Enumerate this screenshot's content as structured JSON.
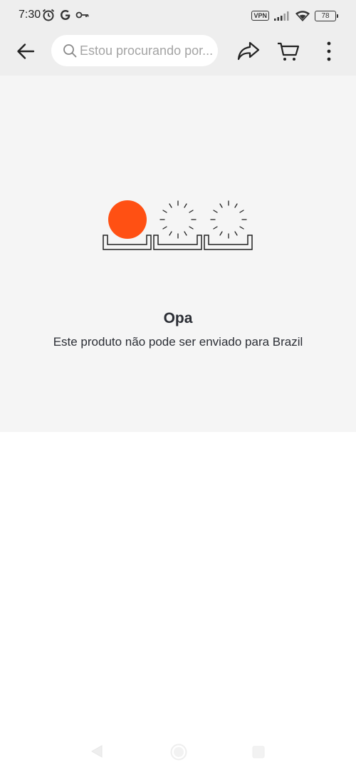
{
  "status_bar": {
    "time": "7:30",
    "left_icons": [
      "alarm-icon",
      "google-icon",
      "key-icon"
    ],
    "vpn_label": "VPN",
    "battery_level": "78",
    "right_icons": [
      "signal-icon",
      "wifi-icon",
      "battery-icon"
    ]
  },
  "header": {
    "back_icon": "arrow-left-icon",
    "search_placeholder": "Estou procurando por...",
    "share_icon": "share-icon",
    "cart_icon": "cart-icon",
    "more_icon": "more-vertical-icon"
  },
  "error": {
    "title": "Opa",
    "message": "Este produto não pode ser enviado para Brazil",
    "accent_color": "#ff5013"
  },
  "nav_bar": {
    "icons": [
      "nav-back-icon",
      "nav-home-icon",
      "nav-recent-icon"
    ]
  }
}
